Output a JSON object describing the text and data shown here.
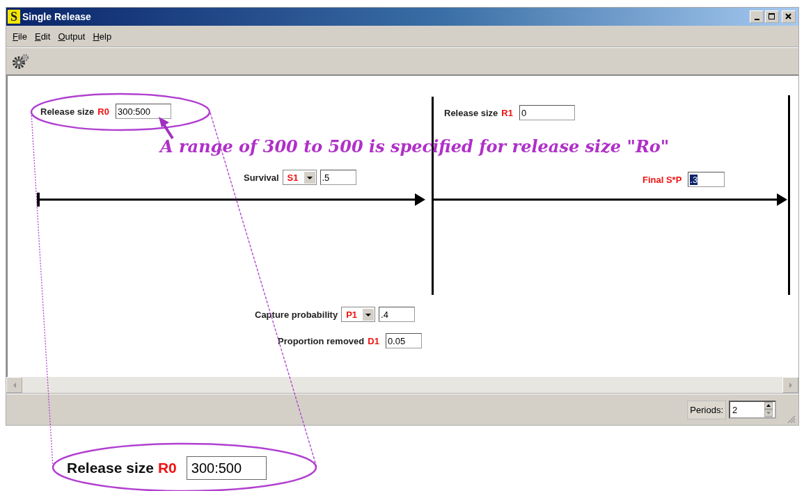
{
  "window": {
    "title": "Single Release",
    "app_letter": "S"
  },
  "menu": [
    {
      "label": "File"
    },
    {
      "label": "Edit"
    },
    {
      "label": "Output"
    },
    {
      "label": "Help"
    }
  ],
  "diagram": {
    "releases": [
      {
        "label": "Release size",
        "code": "R0",
        "value": "300:500"
      },
      {
        "label": "Release size",
        "code": "R1",
        "value": "0"
      }
    ],
    "survival": {
      "label": "Survival",
      "code": "S1",
      "value": ".5"
    },
    "final": {
      "label": "Final S*P",
      "value": ".3",
      "selected": true
    },
    "capture": {
      "label": "Capture probability",
      "code": "P1",
      "value": ".4"
    },
    "removed": {
      "label": "Proportion removed",
      "code": "D1",
      "value": "0.05"
    }
  },
  "status_bar": {
    "periods_label": "Periods:",
    "periods_value": "2"
  },
  "annotation": {
    "text": "A range of 300 to 500 is specified for release size \"Ro\""
  },
  "callout": {
    "label": "Release size",
    "code": "R0",
    "value": "300:500"
  }
}
